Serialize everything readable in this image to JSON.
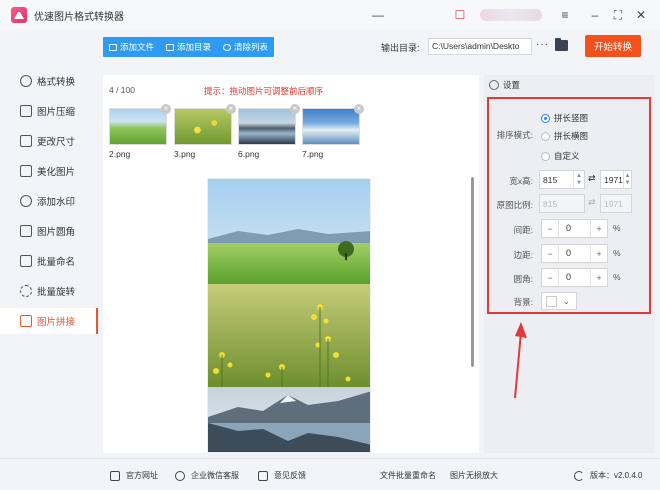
{
  "app": {
    "title": "优速图片格式转换器"
  },
  "sidebar": {
    "items": [
      {
        "label": "格式转换",
        "active": false
      },
      {
        "label": "图片压缩",
        "active": false
      },
      {
        "label": "更改尺寸",
        "active": false
      },
      {
        "label": "美化图片",
        "active": false
      },
      {
        "label": "添加水印",
        "active": false
      },
      {
        "label": "图片圆角",
        "active": false
      },
      {
        "label": "批量命名",
        "active": false
      },
      {
        "label": "批量旋转",
        "active": false
      },
      {
        "label": "图片拼接",
        "active": true
      }
    ]
  },
  "toolbar": {
    "add_file": "添加文件",
    "add_folder": "添加目录",
    "clear_list": "清除列表",
    "output_label": "输出目录:",
    "output_path": "C:\\Users\\admin\\Deskto",
    "more": "···",
    "start": "开始转换"
  },
  "list": {
    "count": "4 / 100",
    "hint": "提示：拖动图片可调整前后顺序",
    "images": [
      {
        "name": "2.png",
        "scene": "meadow"
      },
      {
        "name": "3.png",
        "scene": "flowers"
      },
      {
        "name": "6.png",
        "scene": "lake"
      },
      {
        "name": "7.png",
        "scene": "snow-mountain"
      }
    ]
  },
  "settings": {
    "header": "设置",
    "sort_label": "排序模式:",
    "sort_options": [
      "拼长竖图",
      "拼长横图",
      "自定义"
    ],
    "sort_selected": 0,
    "size_label": "宽x高:",
    "width": "815",
    "height": "1971",
    "ratio_label": "原图比例:",
    "ratio_w": "815",
    "ratio_h": "1971",
    "gap_label": "间距:",
    "gap": "0",
    "margin_label": "边距:",
    "margin": "0",
    "radius_label": "圆角:",
    "radius": "0",
    "unit": "%",
    "bg_label": "背景:",
    "bg_color": "#ffffff"
  },
  "bottom": {
    "website": "官方网址",
    "wechat": "企业微信客服",
    "feedback": "意见反馈",
    "batch_rename": "文件批量重命名",
    "lossless": "图片无损放大",
    "version": "版本：v2.0.4.0"
  },
  "colors": {
    "accent": "#f2511c",
    "primary": "#2f9af2",
    "highlight": "#e03a3a"
  }
}
